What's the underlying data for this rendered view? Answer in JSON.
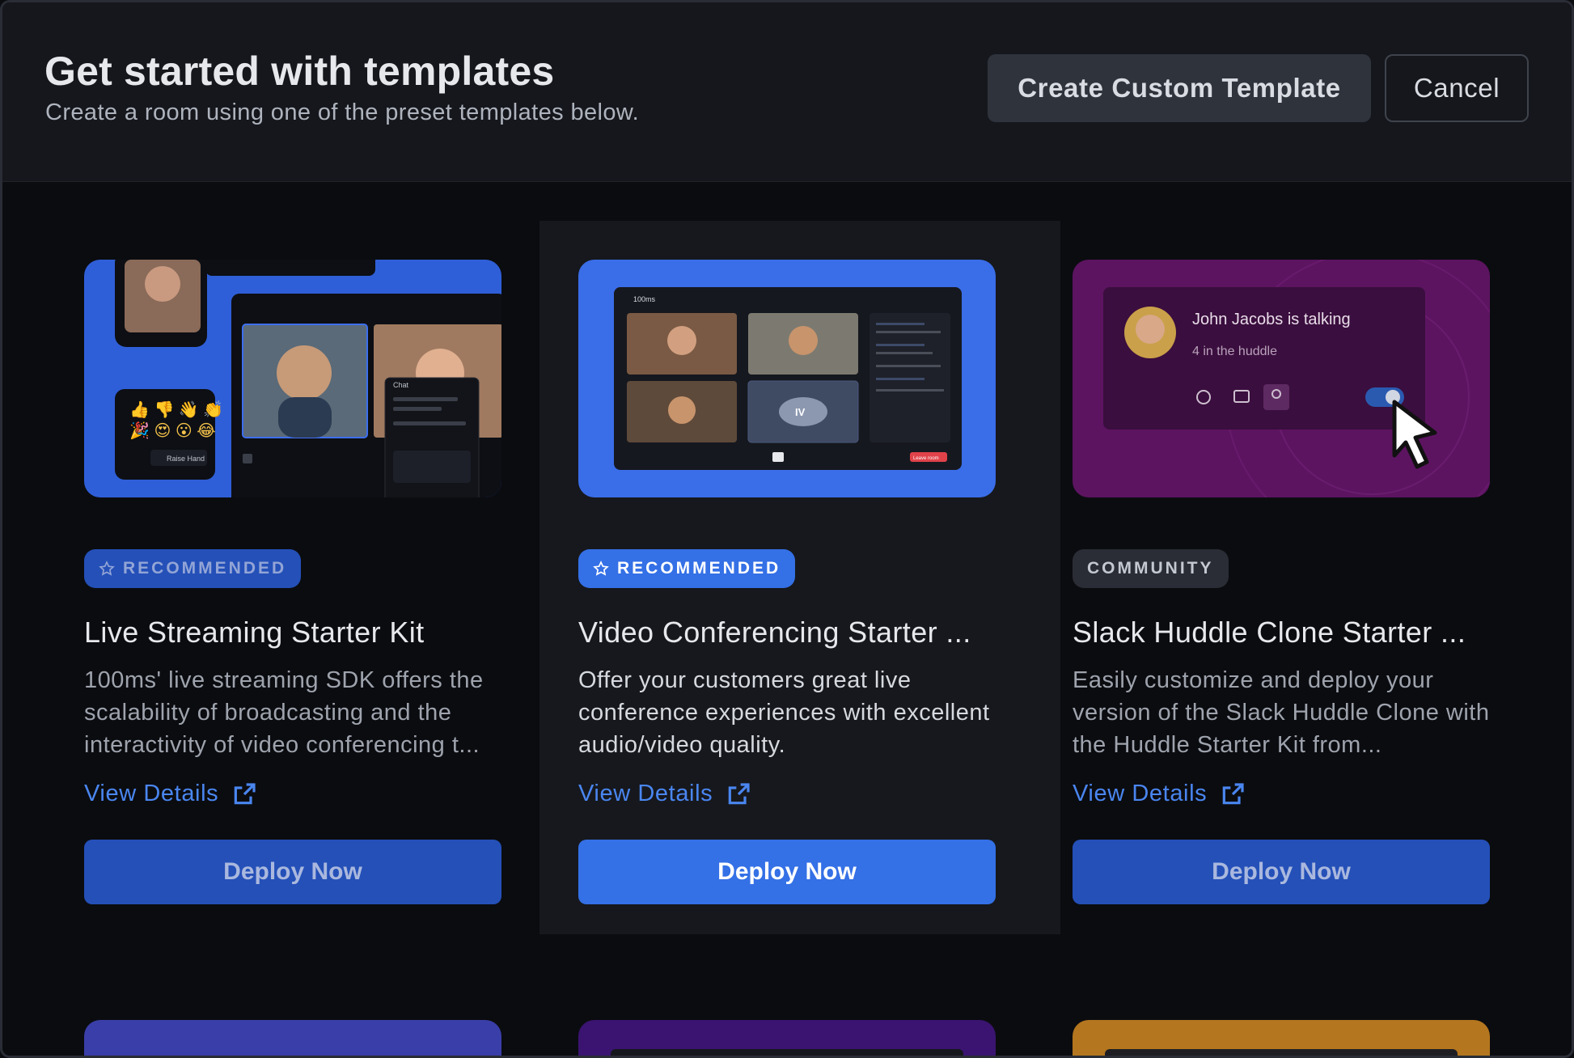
{
  "header": {
    "title": "Get started with templates",
    "subtitle": "Create a room using one of the preset templates below.",
    "create_custom_label": "Create Custom Template",
    "cancel_label": "Cancel"
  },
  "cards": [
    {
      "badge": "RECOMMENDED",
      "title": "Live Streaming Starter Kit",
      "description": "100ms' live streaming SDK offers the scalability of broadcasting and the interactivity of video conferencing t...",
      "view_details": "View Details",
      "deploy": "Deploy Now",
      "thumb": {
        "raise_hand": "Raise Hand",
        "chat": "Chat"
      }
    },
    {
      "badge": "RECOMMENDED",
      "title": "Video Conferencing Starter ...",
      "description": "Offer your customers great live conference experiences with excellent audio/video quality.",
      "view_details": "View Details",
      "deploy": "Deploy Now",
      "thumb": {
        "logo": "100ms",
        "initials": "IV",
        "leave": "Leave room"
      }
    },
    {
      "badge": "COMMUNITY",
      "title": "Slack Huddle Clone Starter ...",
      "description": "Easily customize and deploy your version of the Slack Huddle Clone with the Huddle Starter Kit from...",
      "view_details": "View Details",
      "deploy": "Deploy Now",
      "thumb": {
        "talking": "John Jacobs is talking",
        "huddle_count": "4 in the huddle"
      }
    }
  ],
  "colors": {
    "accent": "#3470e6",
    "badge_recommended_bg": "#2450b8",
    "badge_community_bg": "#2a2d35",
    "huddle_purple": "#5c1460"
  }
}
